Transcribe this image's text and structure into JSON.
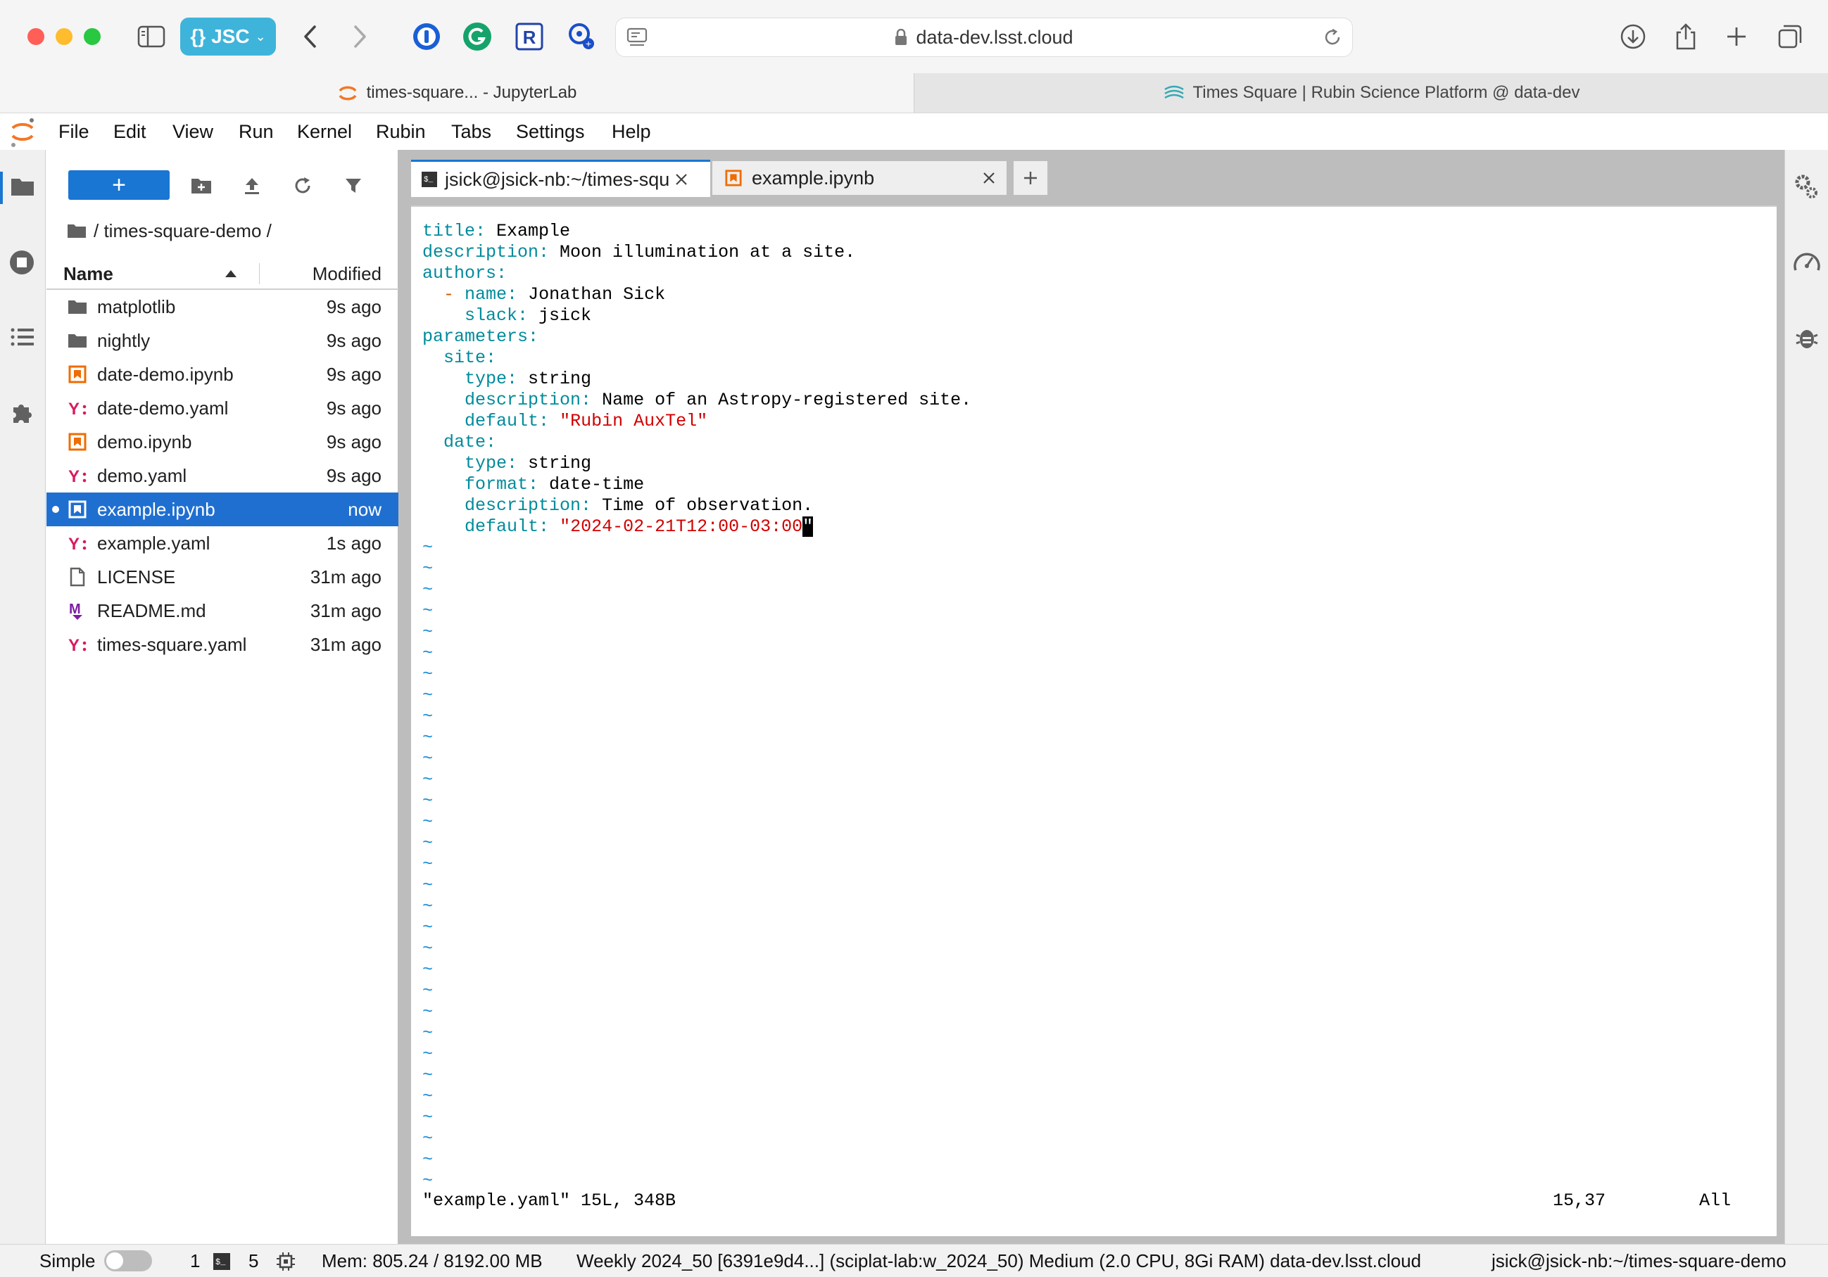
{
  "browser": {
    "profile_label": "JSC",
    "url": "data-dev.lsst.cloud",
    "tabs": [
      {
        "label": "times-square... - JupyterLab"
      },
      {
        "label": "Times Square | Rubin Science Platform @ data-dev"
      }
    ]
  },
  "menu": [
    "File",
    "Edit",
    "View",
    "Run",
    "Kernel",
    "Rubin",
    "Tabs",
    "Settings",
    "Help"
  ],
  "filebrowser": {
    "new_label": "+",
    "breadcrumb": "/ times-square-demo /",
    "col_name": "Name",
    "col_modified": "Modified",
    "files": [
      {
        "name": "matplotlib",
        "modified": "9s ago",
        "icon": "folder-icon"
      },
      {
        "name": "nightly",
        "modified": "9s ago",
        "icon": "folder-icon"
      },
      {
        "name": "date-demo.ipynb",
        "modified": "9s ago",
        "icon": "notebook-icon"
      },
      {
        "name": "date-demo.yaml",
        "modified": "9s ago",
        "icon": "yaml-icon"
      },
      {
        "name": "demo.ipynb",
        "modified": "9s ago",
        "icon": "notebook-icon"
      },
      {
        "name": "demo.yaml",
        "modified": "9s ago",
        "icon": "yaml-icon"
      },
      {
        "name": "example.ipynb",
        "modified": "now",
        "icon": "notebook-icon",
        "selected": true
      },
      {
        "name": "example.yaml",
        "modified": "1s ago",
        "icon": "yaml-icon"
      },
      {
        "name": "LICENSE",
        "modified": "31m ago",
        "icon": "file-icon"
      },
      {
        "name": "README.md",
        "modified": "31m ago",
        "icon": "markdown-icon"
      },
      {
        "name": "times-square.yaml",
        "modified": "31m ago",
        "icon": "yaml-icon"
      }
    ]
  },
  "dock_tabs": [
    {
      "label": "jsick@jsick-nb:~/times-squ",
      "icon": "terminal-icon"
    },
    {
      "label": "example.ipynb",
      "icon": "notebook-icon"
    }
  ],
  "terminal": {
    "lines": [
      {
        "k": "title",
        "v": " Example"
      },
      {
        "k": "description",
        "v": " Moon illumination at a site."
      },
      {
        "k": "authors",
        "v": ""
      },
      {
        "i": "  ",
        "d": "- ",
        "k": "name",
        "v": " Jonathan Sick"
      },
      {
        "i": "    ",
        "k": "slack",
        "v": " jsick"
      },
      {
        "k": "parameters",
        "v": ""
      },
      {
        "i": "  ",
        "k": "site",
        "v": ""
      },
      {
        "i": "    ",
        "k": "type",
        "v": " string"
      },
      {
        "i": "    ",
        "k": "description",
        "v": " Name of an Astropy-registered site."
      },
      {
        "i": "    ",
        "k": "default",
        "s": " \"Rubin AuxTel\""
      },
      {
        "i": "  ",
        "k": "date",
        "v": ""
      },
      {
        "i": "    ",
        "k": "type",
        "v": " string"
      },
      {
        "i": "    ",
        "k": "format",
        "v": " date-time"
      },
      {
        "i": "    ",
        "k": "description",
        "v": " Time of observation."
      },
      {
        "i": "    ",
        "k": "default",
        "s": " \"2024-02-21T12:00-03:00",
        "c": "\""
      }
    ],
    "tilde": "~",
    "tilde_count": 31,
    "status_file": "\"example.yaml\" 15L, 348B",
    "status_pos": "15,37",
    "status_all": "All"
  },
  "statusbar": {
    "mode": "Simple",
    "terminals": "1",
    "kernels": "5",
    "memory": "Mem: 805.24 / 8192.00 MB",
    "image": "Weekly 2024_50 [6391e9d4...] (sciplat-lab:w_2024_50) Medium (2.0 CPU, 8Gi RAM) data-dev.lsst.cloud",
    "terminal_path": "jsick@jsick-nb:~/times-square-demo"
  },
  "colors": {
    "accent": "#1976d2",
    "yaml_key": "#008b9c",
    "yaml_string": "#d10000",
    "jupyter_orange": "#f37726"
  }
}
